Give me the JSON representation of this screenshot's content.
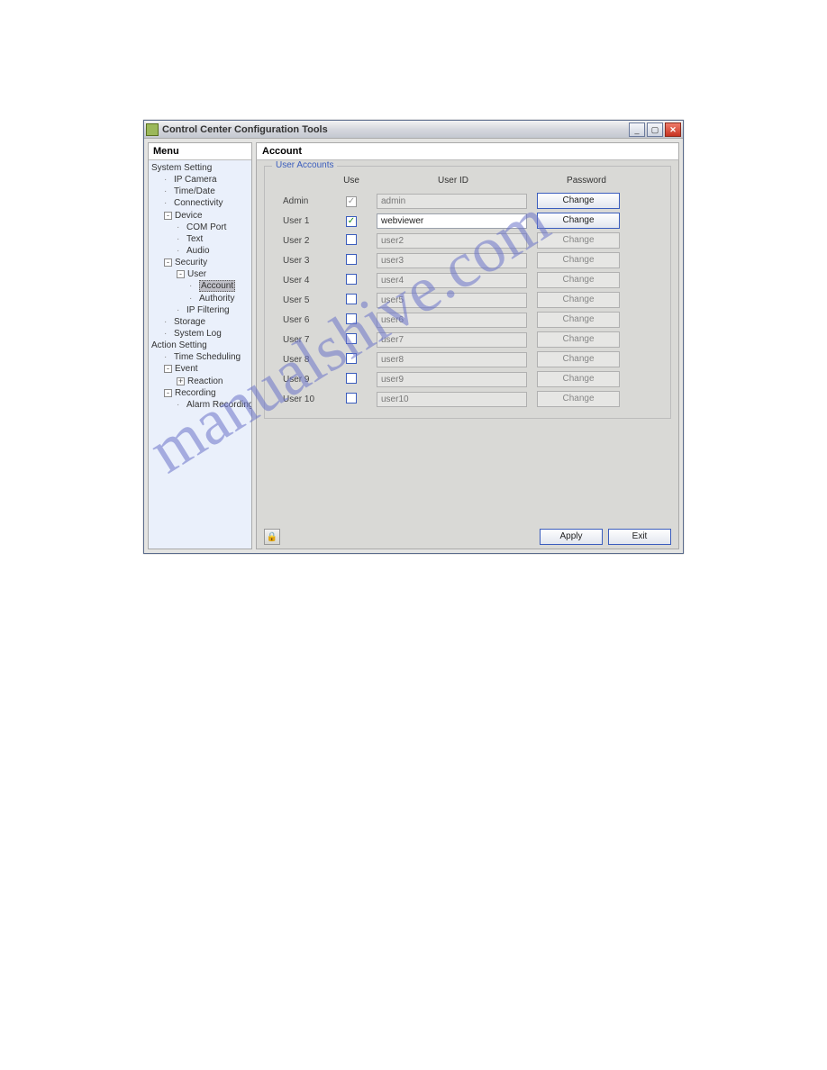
{
  "window": {
    "title": "Control Center Configuration Tools"
  },
  "sidebar": {
    "title": "Menu",
    "items": [
      {
        "label": "System Setting",
        "indent": 0,
        "toggle": ""
      },
      {
        "label": "IP Camera",
        "indent": 1,
        "toggle": "dot"
      },
      {
        "label": "Time/Date",
        "indent": 1,
        "toggle": "dot"
      },
      {
        "label": "Connectivity",
        "indent": 1,
        "toggle": "dot"
      },
      {
        "label": "Device",
        "indent": 1,
        "toggle": "-"
      },
      {
        "label": "COM Port",
        "indent": 2,
        "toggle": "dot"
      },
      {
        "label": "Text",
        "indent": 2,
        "toggle": "dot"
      },
      {
        "label": "Audio",
        "indent": 2,
        "toggle": "dot"
      },
      {
        "label": "Security",
        "indent": 1,
        "toggle": "-"
      },
      {
        "label": "User",
        "indent": 2,
        "toggle": "-"
      },
      {
        "label": "Account",
        "indent": 3,
        "toggle": "dot",
        "selected": true
      },
      {
        "label": "Authority",
        "indent": 3,
        "toggle": "dot"
      },
      {
        "label": "IP Filtering",
        "indent": 2,
        "toggle": "dot"
      },
      {
        "label": "Storage",
        "indent": 1,
        "toggle": "dot"
      },
      {
        "label": "System Log",
        "indent": 1,
        "toggle": "dot"
      },
      {
        "label": "Action Setting",
        "indent": 0,
        "toggle": ""
      },
      {
        "label": "Time Scheduling",
        "indent": 1,
        "toggle": "dot"
      },
      {
        "label": "Event",
        "indent": 1,
        "toggle": "-"
      },
      {
        "label": "Reaction",
        "indent": 2,
        "toggle": "+"
      },
      {
        "label": "Recording",
        "indent": 1,
        "toggle": "-"
      },
      {
        "label": "Alarm Recording",
        "indent": 2,
        "toggle": "dot"
      }
    ]
  },
  "main": {
    "title": "Account",
    "fieldset_title": "User Accounts",
    "headers": {
      "col1": "",
      "col2": "Use",
      "col3": "User ID",
      "col4": "Password"
    },
    "rows": [
      {
        "label": "Admin",
        "checked": true,
        "chk_disabled": true,
        "value": "admin",
        "txt_disabled": true,
        "btn": "Change",
        "btn_disabled": false
      },
      {
        "label": "User 1",
        "checked": true,
        "chk_disabled": false,
        "value": "webviewer",
        "txt_disabled": false,
        "btn": "Change",
        "btn_disabled": false
      },
      {
        "label": "User 2",
        "checked": false,
        "chk_disabled": false,
        "value": "user2",
        "txt_disabled": true,
        "btn": "Change",
        "btn_disabled": true
      },
      {
        "label": "User 3",
        "checked": false,
        "chk_disabled": false,
        "value": "user3",
        "txt_disabled": true,
        "btn": "Change",
        "btn_disabled": true
      },
      {
        "label": "User 4",
        "checked": false,
        "chk_disabled": false,
        "value": "user4",
        "txt_disabled": true,
        "btn": "Change",
        "btn_disabled": true
      },
      {
        "label": "User 5",
        "checked": false,
        "chk_disabled": false,
        "value": "user5",
        "txt_disabled": true,
        "btn": "Change",
        "btn_disabled": true
      },
      {
        "label": "User 6",
        "checked": false,
        "chk_disabled": false,
        "value": "user6",
        "txt_disabled": true,
        "btn": "Change",
        "btn_disabled": true
      },
      {
        "label": "User 7",
        "checked": false,
        "chk_disabled": false,
        "value": "user7",
        "txt_disabled": true,
        "btn": "Change",
        "btn_disabled": true
      },
      {
        "label": "User 8",
        "checked": false,
        "chk_disabled": false,
        "value": "user8",
        "txt_disabled": true,
        "btn": "Change",
        "btn_disabled": true
      },
      {
        "label": "User 9",
        "checked": false,
        "chk_disabled": false,
        "value": "user9",
        "txt_disabled": true,
        "btn": "Change",
        "btn_disabled": true
      },
      {
        "label": "User 10",
        "checked": false,
        "chk_disabled": false,
        "value": "user10",
        "txt_disabled": true,
        "btn": "Change",
        "btn_disabled": true
      }
    ],
    "footer": {
      "apply": "Apply",
      "exit": "Exit"
    }
  },
  "watermark": "manualshive.com"
}
